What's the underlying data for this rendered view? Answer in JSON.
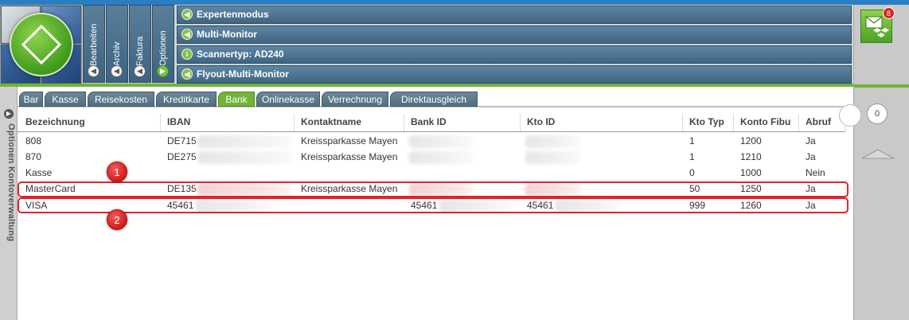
{
  "menu": {
    "columns": [
      {
        "label": "Bearbeiten",
        "icon": "chevron-left-icon"
      },
      {
        "label": "Archiv",
        "icon": "chevron-left-icon"
      },
      {
        "label": "Faktura",
        "icon": "chevron-left-icon"
      },
      {
        "label": "Optionen",
        "icon": "chevron-right-icon"
      }
    ],
    "options": [
      {
        "label": "Expertenmodus",
        "icon": "chevron-left-icon"
      },
      {
        "label": "Multi-Monitor",
        "icon": "chevron-left-icon"
      },
      {
        "label": "Scannertyp: AD240",
        "icon": "info-icon"
      },
      {
        "label": "Flyout-Multi-Monitor",
        "icon": "chevron-left-icon"
      }
    ]
  },
  "notifications": {
    "count": "8",
    "icon": "mail-dropbox-icon"
  },
  "right_panel": {
    "counter": "0"
  },
  "sidebar": {
    "label": "Optionen   Kontoverwaltung"
  },
  "tabs": [
    {
      "label": "Bar"
    },
    {
      "label": "Kasse"
    },
    {
      "label": "Reisekosten"
    },
    {
      "label": "Kreditkarte"
    },
    {
      "label": "Bank",
      "active": true
    },
    {
      "label": "Onlinekasse"
    },
    {
      "label": "Verrechnung"
    },
    {
      "label": "Direktausgleich"
    }
  ],
  "table": {
    "columns": [
      "Bezeichnung",
      "IBAN",
      "Kontaktname",
      "Bank ID",
      "Kto ID",
      "Kto Typ",
      "Konto Fibu",
      "Abruf"
    ],
    "rows": [
      {
        "bezeichnung": "808",
        "iban": "DE715",
        "kontakt": "Kreissparkasse Mayen",
        "bankid": "",
        "ktoid": "",
        "typ": "1",
        "fibu": "1200",
        "abruf": "Ja"
      },
      {
        "bezeichnung": "870",
        "iban": "DE275",
        "kontakt": "Kreissparkasse Mayen",
        "bankid": "",
        "ktoid": "",
        "typ": "1",
        "fibu": "1210",
        "abruf": "Ja"
      },
      {
        "bezeichnung": "Kasse",
        "iban": "",
        "kontakt": "",
        "bankid": "",
        "ktoid": "",
        "typ": "0",
        "fibu": "1000",
        "abruf": "Nein"
      },
      {
        "bezeichnung": "MasterCard",
        "iban": "DE135",
        "kontakt": "Kreissparkasse Mayen",
        "bankid": "",
        "ktoid": "",
        "typ": "50",
        "fibu": "1250",
        "abruf": "Ja"
      },
      {
        "bezeichnung": "VISA",
        "iban": "45461",
        "kontakt": "",
        "bankid": "45461",
        "ktoid": "45461",
        "typ": "999",
        "fibu": "1260",
        "abruf": "Ja"
      }
    ]
  },
  "annotations": [
    {
      "label": "1"
    },
    {
      "label": "2"
    }
  ]
}
